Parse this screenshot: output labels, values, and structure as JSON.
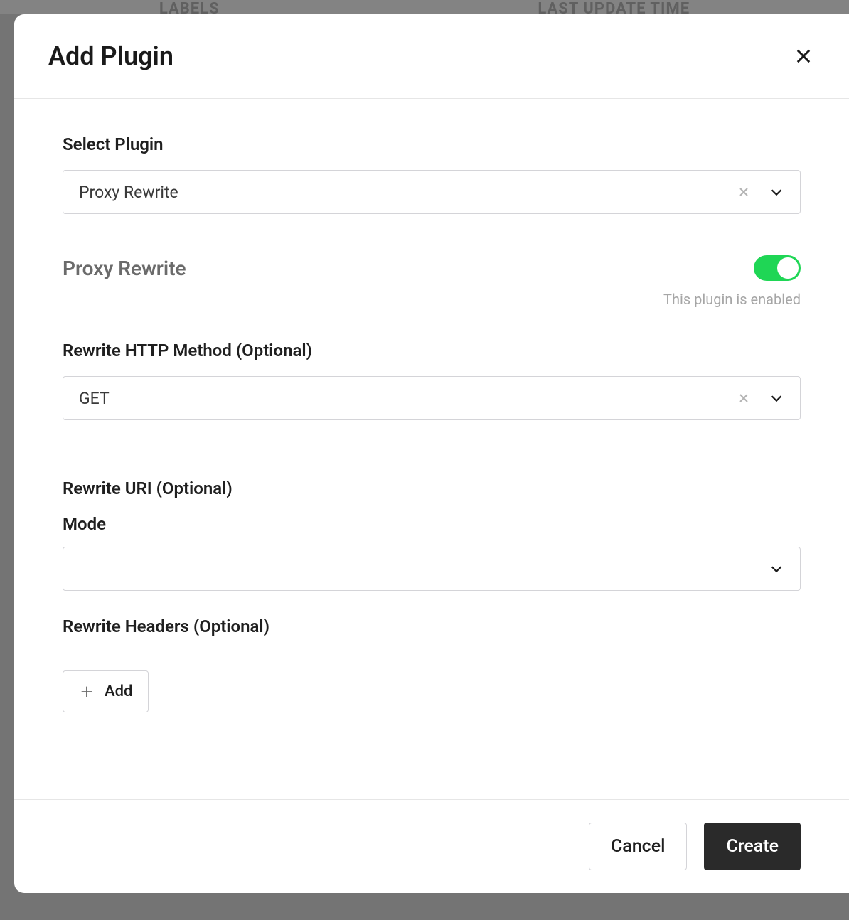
{
  "background": {
    "col_labels": "LABELS",
    "col_update": "LAST UPDATE TIME"
  },
  "modal": {
    "title": "Add Plugin",
    "footer": {
      "cancel": "Cancel",
      "create": "Create"
    }
  },
  "form": {
    "select_plugin_label": "Select Plugin",
    "plugin_select": {
      "value": "Proxy Rewrite"
    },
    "enable": {
      "plugin_name": "Proxy Rewrite",
      "hint": "This plugin is enabled",
      "enabled": true
    },
    "http_method": {
      "label": "Rewrite HTTP Method (Optional)",
      "value": "GET"
    },
    "rewrite_uri": {
      "label": "Rewrite URI (Optional)",
      "mode_label": "Mode",
      "mode_value": ""
    },
    "rewrite_headers": {
      "label": "Rewrite Headers (Optional)",
      "add_label": "Add"
    }
  }
}
